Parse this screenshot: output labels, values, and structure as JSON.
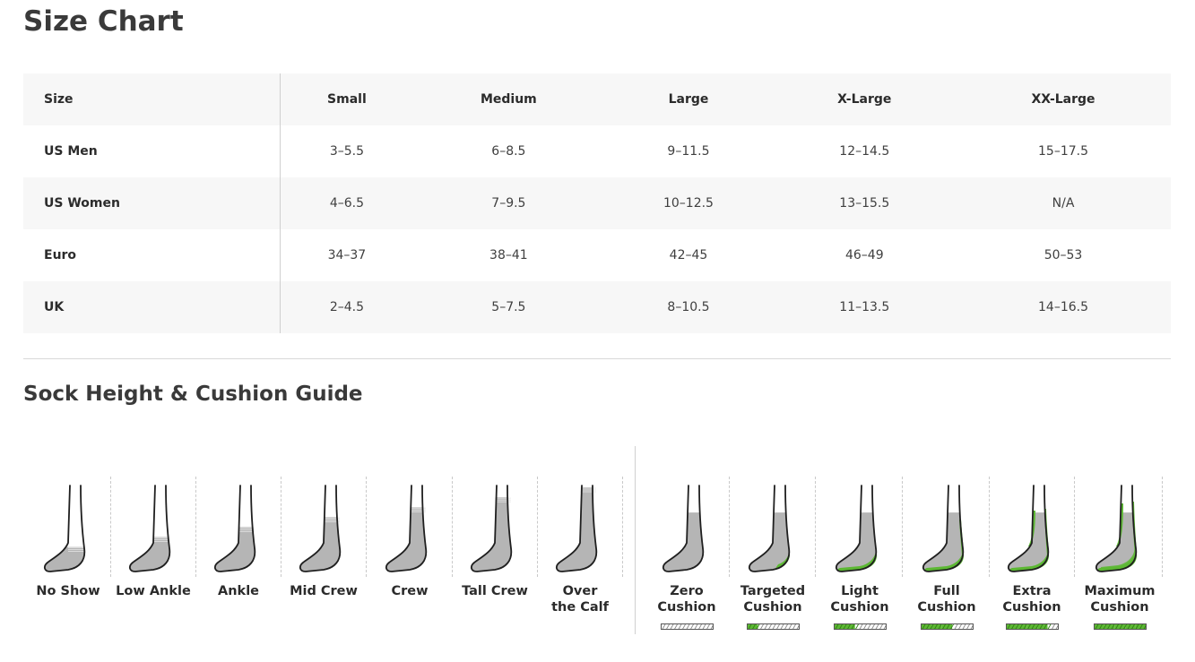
{
  "page_title": "Size Chart",
  "size_table": {
    "headers": [
      "Size",
      "Small",
      "Medium",
      "Large",
      "X-Large",
      "XX-Large"
    ],
    "rows": [
      {
        "label": "US Men",
        "values": [
          "3–5.5",
          "6–8.5",
          "9–11.5",
          "12–14.5",
          "15–17.5"
        ]
      },
      {
        "label": "US Women",
        "values": [
          "4–6.5",
          "7–9.5",
          "10–12.5",
          "13–15.5",
          "N/A"
        ]
      },
      {
        "label": "Euro",
        "values": [
          "34–37",
          "38–41",
          "42–45",
          "46–49",
          "50–53"
        ]
      },
      {
        "label": "UK",
        "values": [
          "2–4.5",
          "5–7.5",
          "8–10.5",
          "11–13.5",
          "14–16.5"
        ]
      }
    ]
  },
  "guide_title": "Sock Height & Cushion Guide",
  "heights": [
    {
      "label_1": "No Show",
      "label_2": "",
      "icon": "sock-no-show-icon",
      "fill_level": 0.1
    },
    {
      "label_1": "Low Ankle",
      "label_2": "",
      "icon": "sock-low-ankle-icon",
      "fill_level": 0.25
    },
    {
      "label_1": "Ankle",
      "label_2": "",
      "icon": "sock-ankle-icon",
      "fill_level": 0.4
    },
    {
      "label_1": "Mid Crew",
      "label_2": "",
      "icon": "sock-mid-crew-icon",
      "fill_level": 0.55
    },
    {
      "label_1": "Crew",
      "label_2": "",
      "icon": "sock-crew-icon",
      "fill_level": 0.7
    },
    {
      "label_1": "Tall Crew",
      "label_2": "",
      "icon": "sock-tall-crew-icon",
      "fill_level": 0.85
    },
    {
      "label_1": "Over",
      "label_2": "the Calf",
      "icon": "sock-over-the-calf-icon",
      "fill_level": 1.0
    }
  ],
  "cushions": [
    {
      "label_1": "Zero",
      "label_2": "Cushion",
      "icon": "sock-zero-cushion-icon",
      "level": 0
    },
    {
      "label_1": "Targeted",
      "label_2": "Cushion",
      "icon": "sock-targeted-cushion-icon",
      "level": 1
    },
    {
      "label_1": "Light",
      "label_2": "Cushion",
      "icon": "sock-light-cushion-icon",
      "level": 2
    },
    {
      "label_1": "Full",
      "label_2": "Cushion",
      "icon": "sock-full-cushion-icon",
      "level": 3
    },
    {
      "label_1": "Extra",
      "label_2": "Cushion",
      "icon": "sock-extra-cushion-icon",
      "level": 4
    },
    {
      "label_1": "Maximum",
      "label_2": "Cushion",
      "icon": "sock-maximum-cushion-icon",
      "level": 5
    }
  ],
  "colors": {
    "cushion_green": "#5cb833",
    "sock_gray": "#b5b5b5",
    "outline": "#1f1f1f"
  }
}
